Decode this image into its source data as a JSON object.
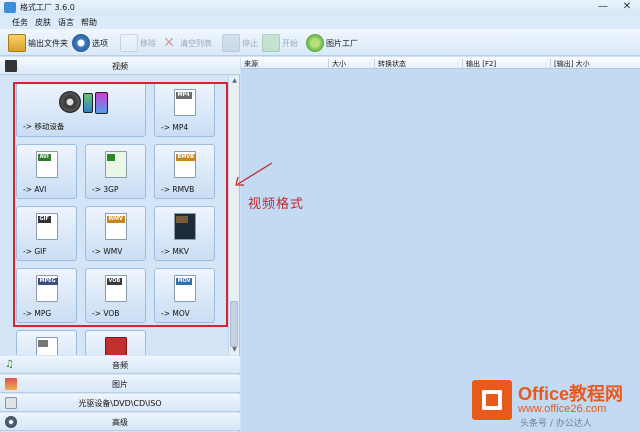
{
  "window": {
    "title": "格式工厂 3.6.0",
    "minimize": "—",
    "close": "✕"
  },
  "menu": [
    "任务",
    "皮肤",
    "语言",
    "帮助"
  ],
  "toolbar": {
    "output_folder": "输出文件夹",
    "options": "选项",
    "remove": "移除",
    "clear_list": "清空列表",
    "stop": "停止",
    "start": "开始",
    "picture_factory": "图片工厂"
  },
  "categories": {
    "video": "视频",
    "audio": "音频",
    "picture": "图片",
    "rom": "光驱设备\\DVD\\CD\\ISO",
    "advanced": "高级"
  },
  "tiles": [
    {
      "label": "-> 移动设备",
      "tag": "",
      "color": "#3a3a3a"
    },
    {
      "label": "-> MP4",
      "tag": "MP4",
      "color": "#6b6b6b"
    },
    {
      "label": "-> AVI",
      "tag": "AVI",
      "color": "#2d7b2d"
    },
    {
      "label": "-> 3GP",
      "tag": "",
      "color": "#2a8a2a"
    },
    {
      "label": "-> RMVB",
      "tag": "RMVB",
      "color": "#c8861f"
    },
    {
      "label": "-> GIF",
      "tag": "GIF",
      "color": "#333333"
    },
    {
      "label": "-> WMV",
      "tag": "WMV",
      "color": "#c8861f"
    },
    {
      "label": "-> MKV",
      "tag": "",
      "color": "#7a5a3a"
    },
    {
      "label": "-> MPG",
      "tag": "MPEG",
      "color": "#3c4f7a"
    },
    {
      "label": "-> VOB",
      "tag": "VOB",
      "color": "#3a3a3a"
    },
    {
      "label": "-> MOV",
      "tag": "MOV",
      "color": "#2f6fb0"
    },
    {
      "label": "",
      "tag": "",
      "color": "#777777"
    },
    {
      "label": "",
      "tag": "",
      "color": "#c22f2f"
    }
  ],
  "columns": [
    "来源",
    "大小",
    "转换状态",
    "输出 [F2]",
    "[输出] 大小"
  ],
  "annotation": "视频格式",
  "watermark": {
    "brand": "Office教程网",
    "site": "www.office26.com",
    "sub": "头条号 / 办公达人"
  }
}
